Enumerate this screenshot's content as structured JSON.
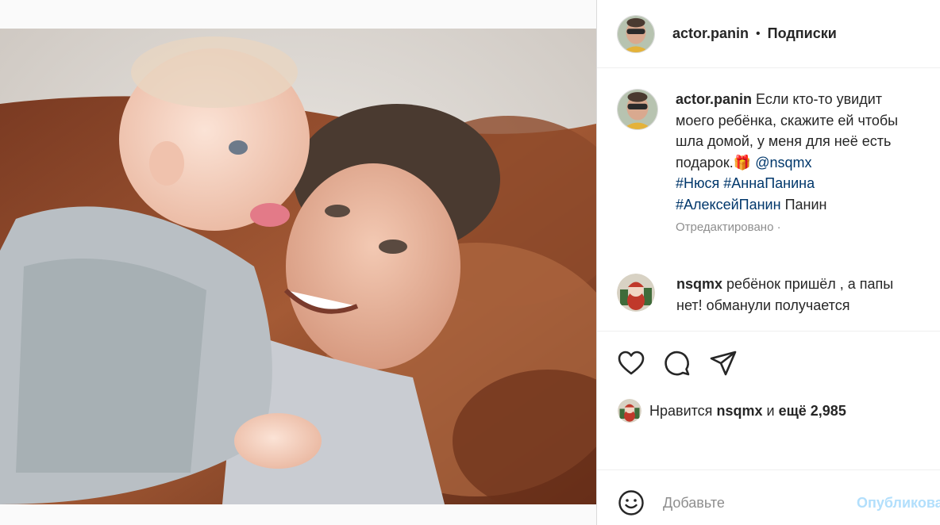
{
  "post": {
    "photo_alt": "photo"
  },
  "header": {
    "username": "actor.panin",
    "separator": "•",
    "follow_label": "Подписки"
  },
  "caption": {
    "username": "actor.panin",
    "line1": "Если кто-то увидит",
    "line2": "моего ребёнка, скажите ей чтобы",
    "line3": "шла домой, у меня для неё есть",
    "line4_text": "подарок.",
    "line4_emoji": "🎁",
    "mention": "@nsqmx",
    "hashtag1": "#Нюся",
    "hashtag2": "#АннаПанина",
    "hashtag3": "#АлексейПанин",
    "trailing_word": "Панин",
    "edited_label": "Отредактировано ·"
  },
  "comment": {
    "username": "nsqmx",
    "line1": "ребёнок пришёл , а папы",
    "line2": "нет! обманули получается"
  },
  "actions": {
    "like_icon": "heart-icon",
    "comment_icon": "comment-bubble-icon",
    "share_icon": "paper-plane-icon"
  },
  "likes": {
    "prefix": "Нравится",
    "user": "nsqmx",
    "middle": "и",
    "count_text": "ещё 2,985"
  },
  "composer": {
    "placeholder": "Добавьте",
    "publish_label": "Опубликовать"
  },
  "colors": {
    "link": "#00376b",
    "muted": "#8e8e8e",
    "publish_disabled": "#b2dffc",
    "border": "#dbdbdb"
  }
}
